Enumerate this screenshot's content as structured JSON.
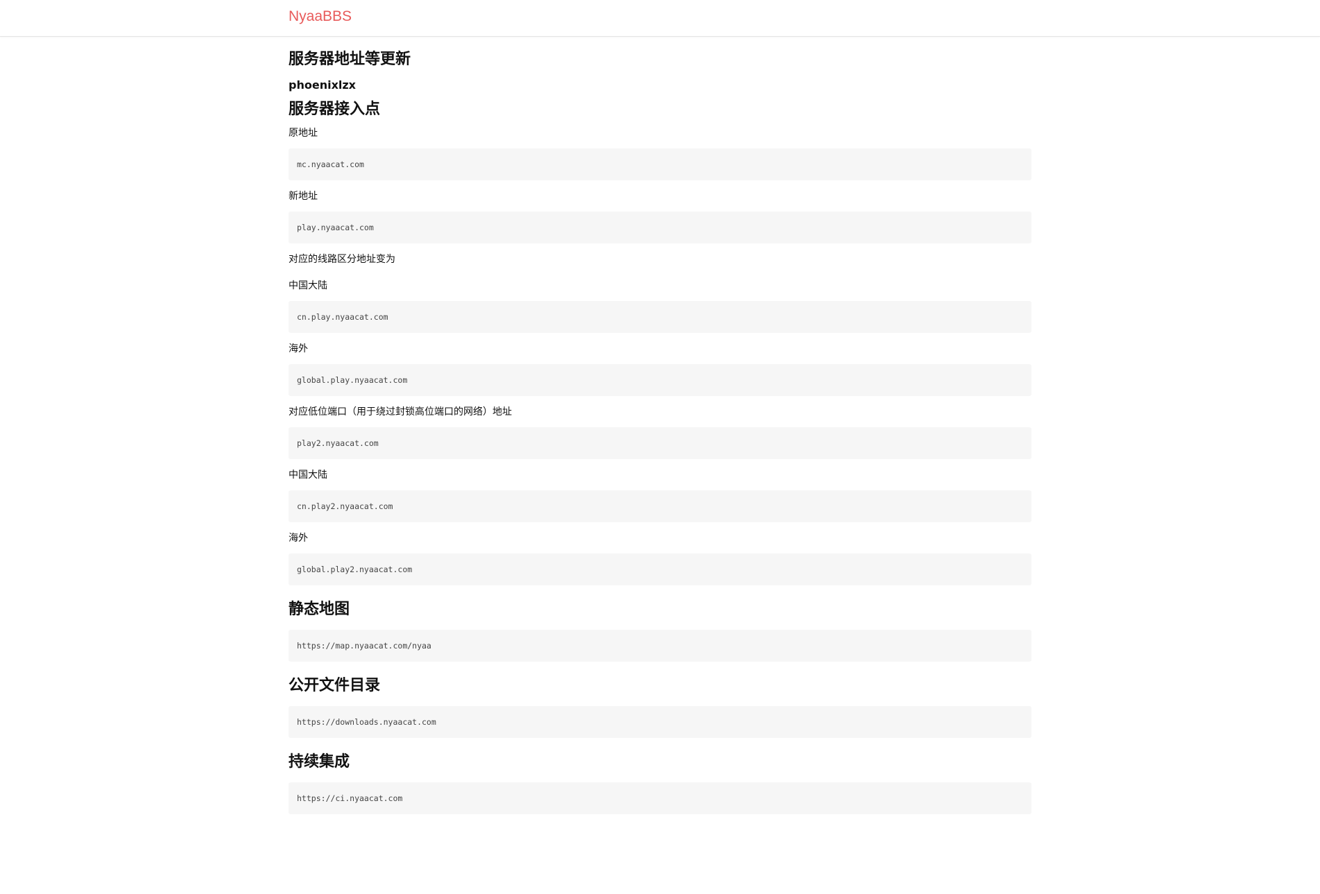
{
  "header": {
    "brand": "NyaaBBS"
  },
  "post": {
    "title": "服务器地址等更新",
    "author": "phoenixlzx"
  },
  "sections": {
    "access_point": {
      "heading": "服务器接入点",
      "original_label": "原地址",
      "original_value": "mc.nyaacat.com",
      "new_label": "新地址",
      "new_value": "play.nyaacat.com",
      "route_intro": "对应的线路区分地址变为",
      "cn_label": "中国大陆",
      "cn_value": "cn.play.nyaacat.com",
      "global_label": "海外",
      "global_value": "global.play.nyaacat.com",
      "low_port_intro": "对应低位端口（用于绕过封锁高位端口的网络）地址",
      "low_port_value": "play2.nyaacat.com",
      "cn2_label": "中国大陆",
      "cn2_value": "cn.play2.nyaacat.com",
      "global2_label": "海外",
      "global2_value": "global.play2.nyaacat.com"
    },
    "static_map": {
      "heading": "静态地图",
      "value": "https://map.nyaacat.com/nyaa"
    },
    "public_files": {
      "heading": "公开文件目录",
      "value": "https://downloads.nyaacat.com"
    },
    "ci": {
      "heading": "持续集成",
      "value": "https://ci.nyaacat.com"
    }
  }
}
